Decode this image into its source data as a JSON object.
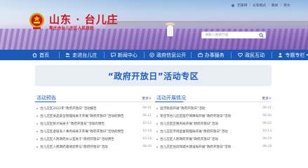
{
  "site": {
    "title": "山东 · 台儿庄",
    "subtitle": "枣庄市台儿庄区人民政府"
  },
  "toplinks": [
    "无障碍",
    "长辈模式",
    "繁体",
    "英文"
  ],
  "search": {
    "placeholder": "请输入搜索内容"
  },
  "nav": [
    {
      "label": "首页",
      "icon": "home-icon"
    },
    {
      "label": "走进台儿庄",
      "icon": "people-icon"
    },
    {
      "label": "新闻中心",
      "icon": "chat-icon"
    },
    {
      "label": "政府信息公开",
      "icon": "compass-icon"
    },
    {
      "label": "办事服务",
      "icon": "briefcase-icon"
    },
    {
      "label": "政民互动",
      "icon": "heart-icon"
    },
    {
      "label": "专题专栏",
      "icon": "user-icon"
    }
  ],
  "promo": {
    "title": "“政府开放日”活动专区"
  },
  "left_column": {
    "title": "活动预告",
    "more": "更多",
    "items": [
      {
        "text": "台儿庄区2022年“政府开放日”活动报告",
        "date": "09-01"
      },
      {
        "text": "台儿庄区食品安全管理局关于开展“政府开放日”活动的预告",
        "date": "06-21"
      },
      {
        "text": "台儿庄区统计局关于“政府开放日”活动的预告",
        "date": "10-12"
      },
      {
        "text": "台儿庄区退役军人事务局关于开展“政府开放日”活动的预告",
        "date": "10-18"
      },
      {
        "text": "台儿庄区人民政府办公室关于“政府开放日”活动预告",
        "date": "10-18"
      },
      {
        "text": "台儿庄区人民政府邀请您参与“政府开放日”活动",
        "date": "08-26"
      }
    ]
  },
  "right_column": {
    "title": "活动开展情况",
    "more": "更多",
    "items": [
      {
        "text": "运河街道开展“政府开放日”活动",
        "date": "06-21"
      },
      {
        "text": "枣庄市台儿庄区医疗保障局开展“政府开放日”活动",
        "date": "09-20"
      },
      {
        "text": "台儿庄区区税务局开展“政府开放日”活动",
        "date": "09-22"
      },
      {
        "text": "台儿庄区市场监督管理局开展“政府开放日”活动",
        "date": "10-13"
      },
      {
        "text": "台儿庄区人民政府开展“政府开放日”活动",
        "date": "09-19"
      },
      {
        "text": "台儿庄区住房和城乡建设局开展“政府开放日”活动",
        "date": "09-28"
      }
    ]
  }
}
